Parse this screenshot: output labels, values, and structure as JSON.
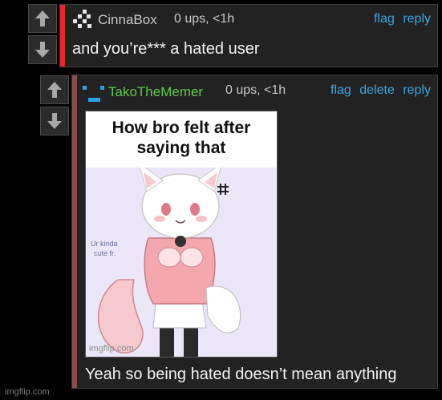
{
  "colors": {
    "bg": "#000000",
    "panel": "#222222",
    "link": "#36a6e8",
    "stripe_red": "#e8262e",
    "stripe_dim": "#8a4c4c",
    "user_gray": "#c8c8c8",
    "user_green": "#62c84c"
  },
  "comment1": {
    "username": "CinnaBox",
    "meta": "0 ups, <1h",
    "actions": [
      "flag",
      "reply"
    ],
    "text": "and you’re*** a hated user",
    "avatar_icon": "pixel-avatar-icon"
  },
  "comment2": {
    "username": "TakoTheMemer",
    "meta": "0 ups, <1h",
    "actions": [
      "flag",
      "delete",
      "reply"
    ],
    "text": "Yeah so being hated doesn’t mean anything",
    "avatar_icon": "pixel-face-avatar-icon",
    "meme": {
      "caption_line1": "How bro felt after",
      "caption_line2": "saying that",
      "handwriting": "Ur kinda cute fr.",
      "source": "imgflip.com"
    }
  },
  "icons": {
    "upvote": "arrow-up-icon",
    "downvote": "arrow-down-icon"
  },
  "watermark": "imgflip.com"
}
